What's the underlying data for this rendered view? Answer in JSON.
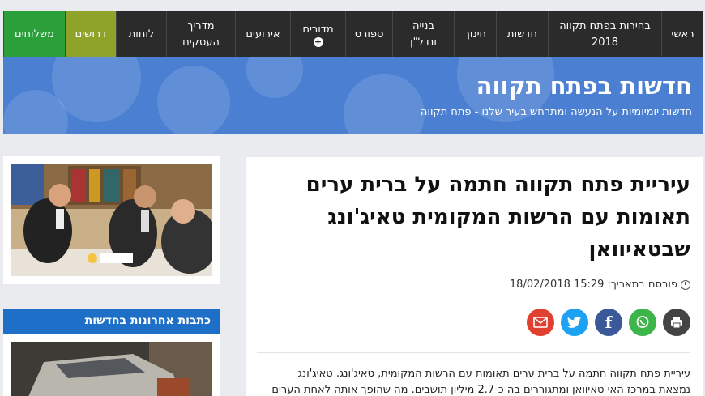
{
  "nav": {
    "items": [
      {
        "lines": [
          "ראשי"
        ]
      },
      {
        "lines": [
          "בחירות בפתח תקווה",
          "2018"
        ]
      },
      {
        "lines": [
          "חדשות"
        ]
      },
      {
        "lines": [
          "חינוך"
        ]
      },
      {
        "lines": [
          "בנייה",
          "ונדל\"ן"
        ]
      },
      {
        "lines": [
          "ספורט"
        ]
      },
      {
        "lines": [
          "מדורים"
        ]
      },
      {
        "lines": [
          "אירועים"
        ]
      },
      {
        "lines": [
          "מדריך",
          "העסקים"
        ]
      },
      {
        "lines": [
          "לוחות"
        ]
      },
      {
        "lines": [
          "דרושים"
        ]
      },
      {
        "lines": [
          "משלוחים"
        ]
      }
    ]
  },
  "header": {
    "title": "חדשות בפתח תקווה",
    "tagline": "חדשות יומיומיות על הנעשה ומתרחש בעיר שלנו - פתח תקווה"
  },
  "article": {
    "headline": "עיריית פתח תקווה חתמה על ברית ערים תאומות עם הרשות המקומית טאיג'ונג שבטאיוואן",
    "posted_label": "פורסם בתאריך:",
    "posted_value": "18/02/2018 15:29",
    "excerpt_line1": "עיריית פתח תקווה חתמה על ברית ערים תאומות עם הרשות המקומית, טאיג'ונג. טאיג'ונג",
    "excerpt_line2": "נמצאת במרכז האי טאיוואן ומתגוררים בה כ-2.7 מיליון תושבים. מה שהופך אותה לאחת הערים"
  },
  "share": {
    "print": "print-icon",
    "whatsapp": "whatsapp-icon",
    "facebook": "facebook-icon",
    "twitter": "twitter-icon",
    "email": "email-icon",
    "colors": {
      "print": "#444444",
      "whatsapp": "#3db54a",
      "facebook": "#3b5998",
      "twitter": "#1da1f2",
      "email": "#e0402f"
    }
  },
  "sidebar": {
    "latest_title": "כתבות אחרונות בחדשות"
  },
  "colors": {
    "nav_bg": "#2b2b2b",
    "banner_bg": "#4a7fd1",
    "hot_tab": "#8fa32a",
    "delivery_tab": "#2ba03a",
    "section_head": "#1d6fc7"
  }
}
